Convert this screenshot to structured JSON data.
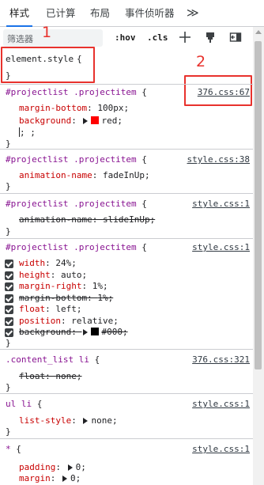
{
  "tabs": [
    {
      "label": "样式",
      "active": true
    },
    {
      "label": "已计算"
    },
    {
      "label": "布局"
    },
    {
      "label": "事件侦听器"
    }
  ],
  "more_tabs": "≫",
  "toolbar": {
    "filter_placeholder": "筛选器",
    "hov": ":hov",
    "cls": ".cls"
  },
  "annotations": {
    "one": "1",
    "two": "2",
    "color": "#e8322d"
  },
  "element_style": {
    "selector": "element.style",
    "open": "{",
    "close": "}"
  },
  "rules": [
    {
      "selector": "#projectlist .projectitem",
      "source": "376.css:67",
      "props": [
        {
          "name": "margin-bottom",
          "value": "100px;"
        },
        {
          "name": "background",
          "value": "red;",
          "swatch": "#ff0000"
        },
        {
          "name": "",
          "value": ";"
        }
      ]
    },
    {
      "selector": "#projectlist .projectitem",
      "source": "style.css:38",
      "props": [
        {
          "name": "animation-name",
          "value": "fadeInUp;"
        }
      ]
    },
    {
      "selector": "#projectlist .projectitem",
      "source": "style.css:1",
      "props": [
        {
          "name": "animation-name",
          "value": "slideInUp;",
          "struck": true
        }
      ]
    },
    {
      "selector": "#projectlist .projectitem",
      "source": "style.css:1",
      "props": [
        {
          "name": "width",
          "value": "24%;"
        },
        {
          "name": "height",
          "value": "auto;"
        },
        {
          "name": "margin-right",
          "value": "1%;"
        },
        {
          "name": "margin-bottom",
          "value": "1%;",
          "struck": true
        },
        {
          "name": "float",
          "value": "left;"
        },
        {
          "name": "position",
          "value": "relative;"
        },
        {
          "name": "background",
          "value": "#000;",
          "struck": true,
          "swatch": "#000000"
        }
      ]
    },
    {
      "selector": ".content_list li",
      "source": "376.css:321",
      "props": [
        {
          "name": "float",
          "value": "none;",
          "struck": true
        }
      ]
    },
    {
      "selector": "ul li",
      "source": "style.css:1",
      "props": [
        {
          "name": "list-style",
          "value": "none;"
        }
      ]
    },
    {
      "selector": "*",
      "source": "style.css:1",
      "props": [
        {
          "name": "padding",
          "value": "0;"
        },
        {
          "name": "margin",
          "value": "0;"
        }
      ]
    }
  ]
}
